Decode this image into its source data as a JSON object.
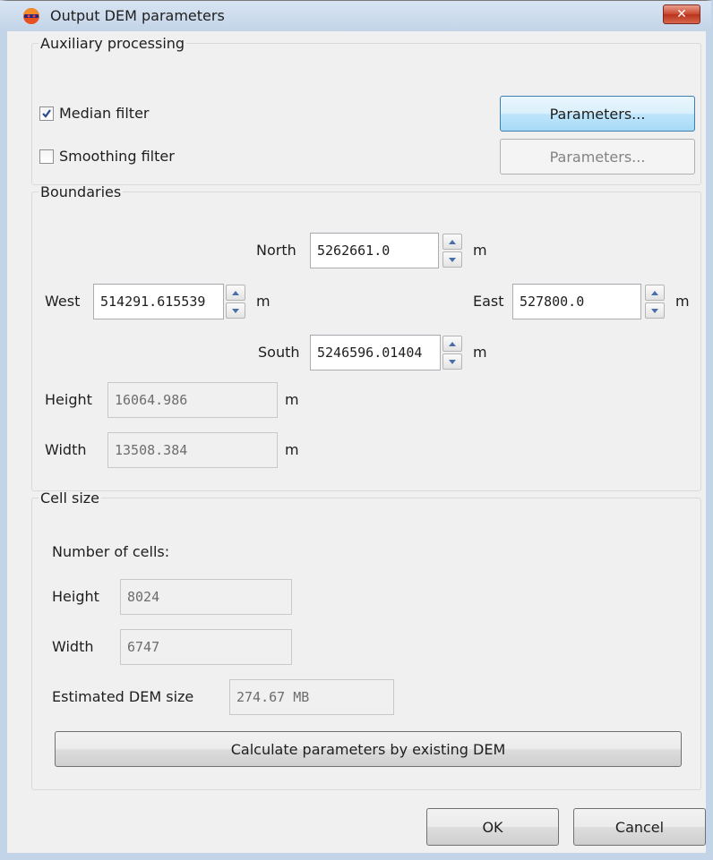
{
  "window": {
    "title": "Output DEM parameters",
    "close_glyph": "✕"
  },
  "auxiliary": {
    "legend": "Auxiliary processing",
    "median_filter": {
      "label": "Median filter",
      "checked": true
    },
    "smoothing_filter": {
      "label": "Smoothing filter",
      "checked": false
    },
    "median_params_button": "Parameters...",
    "smoothing_params_button": "Parameters..."
  },
  "boundaries": {
    "legend": "Boundaries",
    "north": {
      "label": "North",
      "value": "5262661.0",
      "unit": "m"
    },
    "west": {
      "label": "West",
      "value": "514291.615539",
      "unit": "m"
    },
    "east": {
      "label": "East",
      "value": "527800.0",
      "unit": "m"
    },
    "south": {
      "label": "South",
      "value": "5246596.01404",
      "unit": "m"
    },
    "height": {
      "label": "Height",
      "value": "16064.986",
      "unit": "m"
    },
    "width": {
      "label": "Width",
      "value": "13508.384",
      "unit": "m"
    }
  },
  "cell_size": {
    "legend": "Cell size",
    "number_of_cells_label": "Number of cells:",
    "height": {
      "label": "Height",
      "value": "8024"
    },
    "width": {
      "label": "Width",
      "value": "6747"
    },
    "estimated": {
      "label": "Estimated DEM size",
      "value": "274.67 MB"
    },
    "calculate_button": "Calculate parameters by existing DEM"
  },
  "footer": {
    "ok": "OK",
    "cancel": "Cancel"
  },
  "colors": {
    "focus_blue": "#3c7fb1",
    "title_bar": "#c3d4e8",
    "close_red": "#c9462c"
  }
}
